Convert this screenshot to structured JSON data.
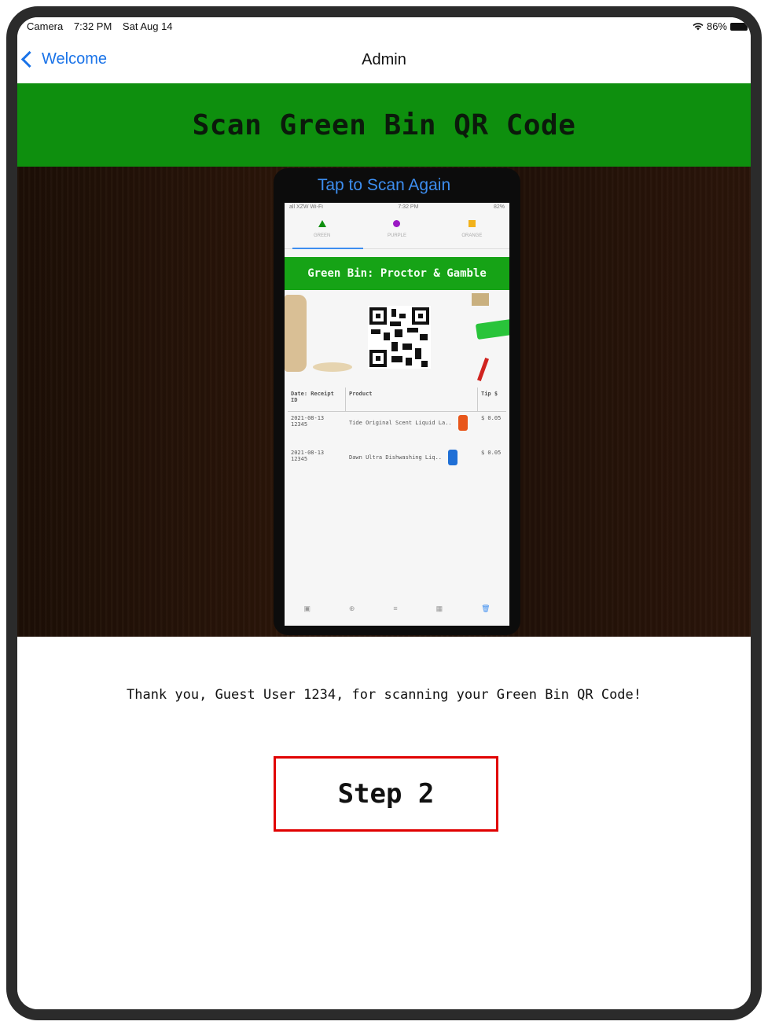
{
  "status_bar": {
    "app": "Camera",
    "time": "7:32 PM",
    "date": "Sat Aug 14",
    "battery": "86%"
  },
  "nav": {
    "back_label": "Welcome",
    "title": "Admin"
  },
  "banner": {
    "title": "Scan Green Bin QR Code",
    "color": "#0e8f0e"
  },
  "camera": {
    "scan_again_label": "Tap to Scan Again",
    "phone_screen": {
      "status_left": "all XZW Wi-Fi",
      "status_time": "7:32 PM",
      "status_right": "82%",
      "tabs": [
        {
          "label": "GREEN",
          "icon": "triangle-icon",
          "color": "#0e8f0e"
        },
        {
          "label": "PURPLE",
          "icon": "circle-icon",
          "color": "#9b19c4"
        },
        {
          "label": "ORANGE",
          "icon": "square-icon",
          "color": "#f2b21b"
        }
      ],
      "bin_title": "Green Bin: Proctor & Gamble",
      "table": {
        "headers": [
          "Date: Receipt ID",
          "Product",
          "Tip $"
        ],
        "rows": [
          {
            "date": "2021-08-13",
            "receipt": "12345",
            "product": "Tide Original Scent Liquid La..",
            "tip": "$ 0.05"
          },
          {
            "date": "2021-08-13",
            "receipt": "12345",
            "product": "Dawn Ultra Dishwashing Liq..",
            "tip": "$ 0.05"
          }
        ]
      },
      "bottom_icons": [
        "qr-icon",
        "plus-icon",
        "list-icon",
        "grid-icon",
        "trash-icon"
      ]
    }
  },
  "thanks_message": "Thank you, Guest User 1234, for scanning your Green Bin QR Code!",
  "step_button": {
    "label": "Step 2",
    "border_color": "#e00000"
  }
}
